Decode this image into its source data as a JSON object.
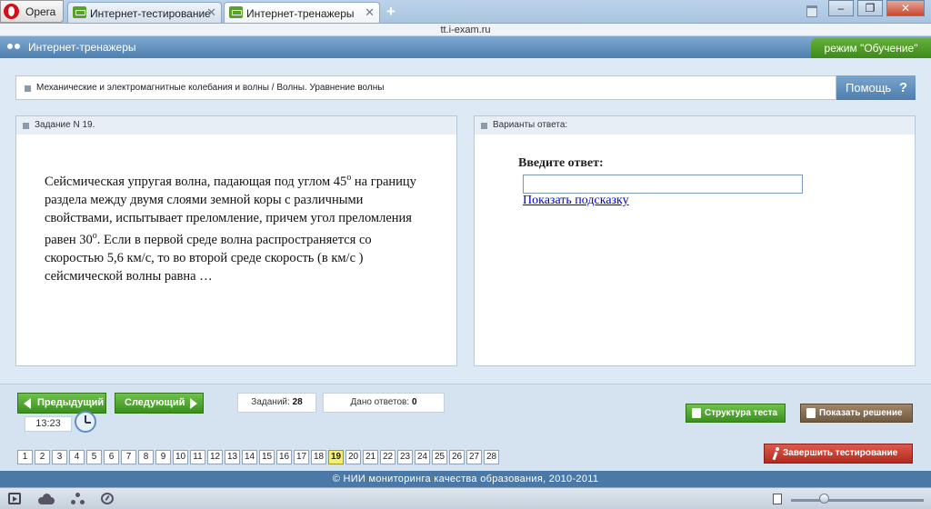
{
  "browser": {
    "menu_label": "Opera",
    "tabs": [
      {
        "title": "Интернет-тестирование",
        "close": "✕"
      },
      {
        "title": "Интернет-тренажеры",
        "close": "✕"
      }
    ],
    "new_tab": "+",
    "window_controls": {
      "minimize": "–",
      "maximize": "❐",
      "close": "✕"
    },
    "url": "tt.i-exam.ru"
  },
  "app": {
    "title": "Интернет-тренажеры",
    "mode": "режим \"Обучение\""
  },
  "topic": {
    "breadcrumb": "Механические и электромагнитные колебания и волны / Волны. Уравнение волны",
    "help_label": "Помощь",
    "help_icon": "?"
  },
  "task": {
    "panel_title": "Задание N 19.",
    "text_part1": "Сейсмическая упругая волна, падающая под углом 45",
    "sup1": "o",
    "text_part2": " на границу раздела между двумя слоями земной коры с различными свойствами, испытывает преломление, причем угол преломления равен 30",
    "sup2": "o",
    "text_part3": ". Если в первой среде волна распространяется со скоростью 5,6 км/с, то во второй среде скорость (в км/с ) сейсмической волны равна …"
  },
  "answer": {
    "panel_title": "Варианты ответа:",
    "label": "Введите ответ:",
    "value": "",
    "hint_link": "Показать подсказку"
  },
  "navigation": {
    "prev_label": "Предыдущий",
    "next_label": "Следующий",
    "timer": "13:23",
    "tasks_label": "Заданий:",
    "tasks_count": "28",
    "answered_label": "Дано ответов:",
    "answered_count": "0",
    "structure_label": "Структура теста",
    "solution_label": "Показать решение",
    "finish_label": "Завершить тестирование",
    "pages": [
      "1",
      "2",
      "3",
      "4",
      "5",
      "6",
      "7",
      "8",
      "9",
      "10",
      "11",
      "12",
      "13",
      "14",
      "15",
      "16",
      "17",
      "18",
      "19",
      "20",
      "21",
      "22",
      "23",
      "24",
      "25",
      "26",
      "27",
      "28"
    ],
    "current_page": "19"
  },
  "footer": {
    "copyright": "© НИИ мониторинга качества образования, 2010-2011"
  },
  "colors": {
    "header_blue": "#4f7fae",
    "mode_green": "#3d8a1a",
    "nav_green": "#3a8f1e",
    "solution_brown": "#6f5a40",
    "finish_red": "#b12a1f",
    "current_page_yellow": "#f5f06a"
  },
  "icons": [
    "opera-logo-icon",
    "tab-site-icon",
    "trash-icon",
    "app-logo-icon",
    "help-icon",
    "clock-icon",
    "structure-icon",
    "solution-icon",
    "runner-icon",
    "panel-toggle-icon",
    "cloud-icon",
    "unite-icon",
    "speed-dial-icon",
    "page-icon"
  ]
}
